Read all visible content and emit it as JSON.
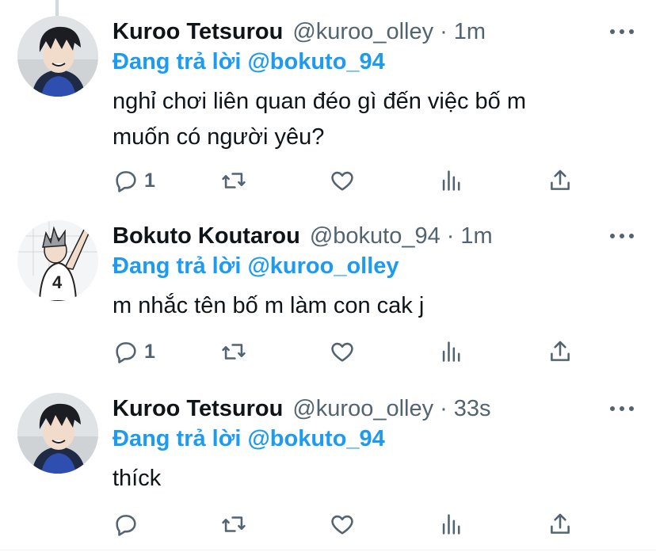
{
  "tweets": [
    {
      "name": "Kuroo Tetsurou",
      "handle": "@kuroo_olley",
      "time": "1m",
      "reply_prefix": "Đang trả lời",
      "reply_handle": "@bokuto_94",
      "text_lines": [
        "nghỉ chơi liên quan đéo gì đến việc bố m",
        "muốn có người yêu?"
      ],
      "reply_count": "1",
      "avatar_icon": "avatar-kuroo"
    },
    {
      "name": "Bokuto Koutarou",
      "handle": "@bokuto_94",
      "time": "1m",
      "reply_prefix": "Đang trả lời",
      "reply_handle": "@kuroo_olley",
      "text_lines": [
        "m nhắc tên bố m làm con cak j"
      ],
      "reply_count": "1",
      "avatar_icon": "avatar-bokuto",
      "avatar_number": "4"
    },
    {
      "name": "Kuroo Tetsurou",
      "handle": "@kuroo_olley",
      "time": "33s",
      "reply_prefix": "Đang trả lời",
      "reply_handle": "@bokuto_94",
      "text_lines": [
        "thíck"
      ],
      "reply_count": "",
      "avatar_icon": "avatar-kuroo"
    }
  ],
  "separator": "·",
  "colors": {
    "accent": "#1d9bf0",
    "secondary_text": "#536471",
    "primary_text": "#0f1419"
  },
  "icons": [
    "reply-icon",
    "retweet-icon",
    "like-icon",
    "views-icon",
    "share-icon",
    "more-icon"
  ]
}
